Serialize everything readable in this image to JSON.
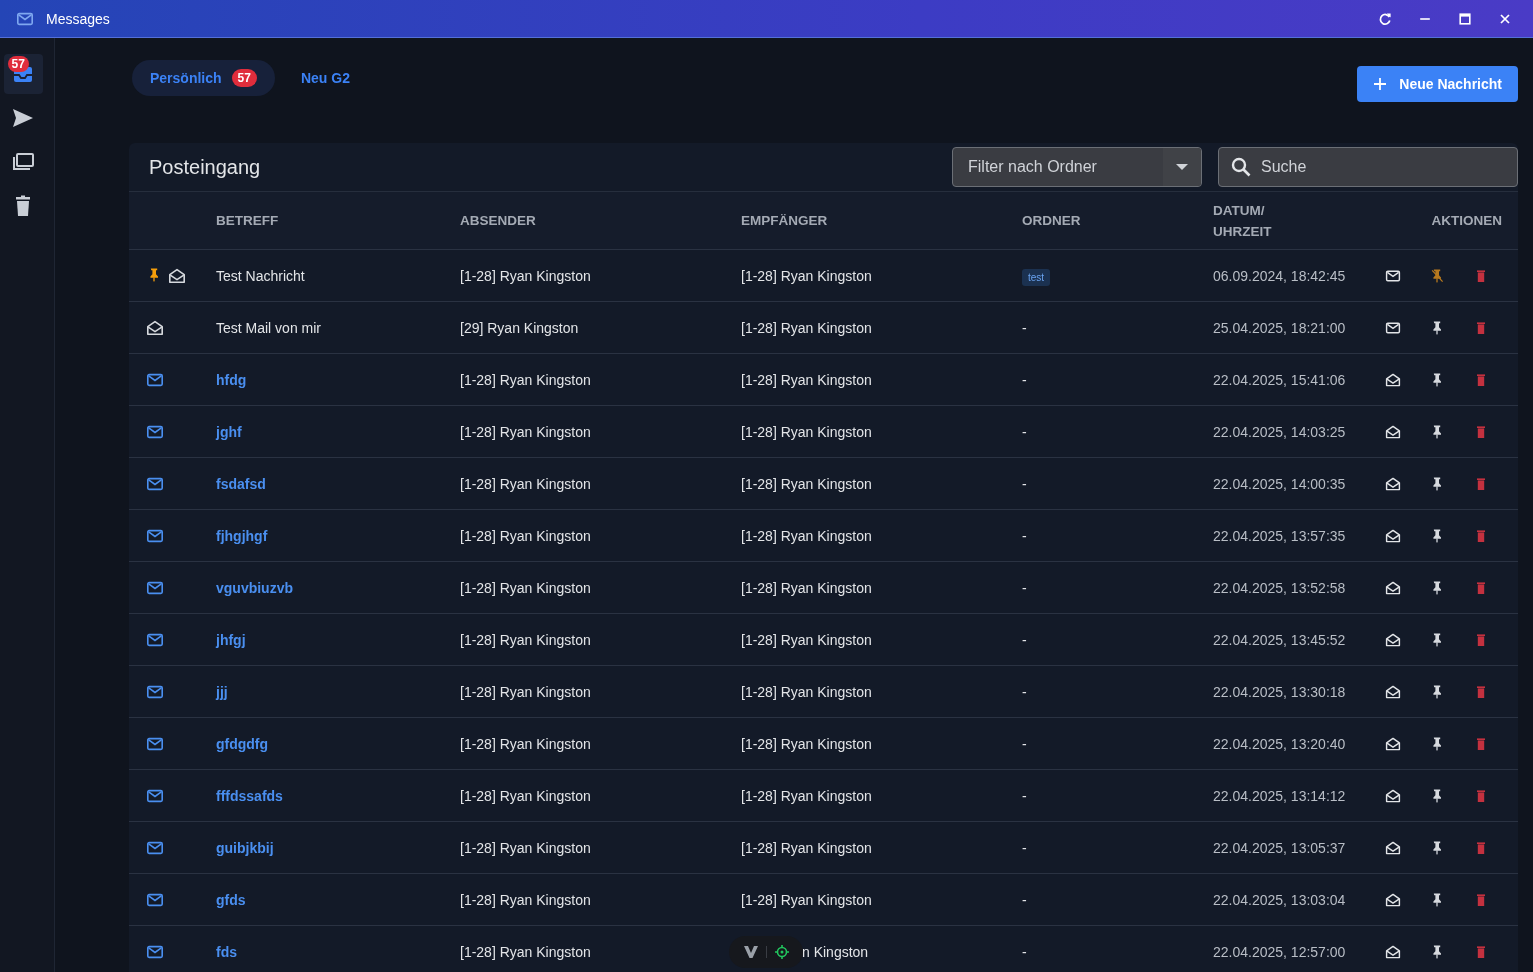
{
  "window": {
    "title": "Messages"
  },
  "sidebar": {
    "items": [
      {
        "kind": "inbox",
        "badge": "57",
        "selected": true
      },
      {
        "kind": "sent",
        "selected": false
      },
      {
        "kind": "folders",
        "selected": false
      },
      {
        "kind": "trash",
        "selected": false
      }
    ]
  },
  "tabs": [
    {
      "label": "Persönlich",
      "badge": "57",
      "selected": true
    },
    {
      "label": "Neu G2",
      "selected": false
    }
  ],
  "new_button": {
    "label": "Neue Nachricht"
  },
  "inbox": {
    "title": "Posteingang",
    "folder_filter": {
      "placeholder": "Filter nach Ordner"
    },
    "search": {
      "placeholder": "Suche"
    }
  },
  "table": {
    "columns": [
      "BETREFF",
      "ABSENDER",
      "EMPFÄNGER",
      "ORDNER",
      "DATUM/ UHRZEIT",
      "AKTIONEN"
    ],
    "rows": [
      {
        "pinned": true,
        "read": true,
        "subject": "Test Nachricht",
        "sender": "[1-28] Ryan Kingston",
        "recipient": "[1-28] Ryan Kingston",
        "folder": {
          "kind": "tag",
          "text": "test"
        },
        "date": "06.09.2024, 18:42:45"
      },
      {
        "pinned": false,
        "read": true,
        "subject": "Test Mail von mir",
        "sender": "[29] Ryan Kingston",
        "recipient": "[1-28] Ryan Kingston",
        "folder": {
          "kind": "text",
          "text": "-"
        },
        "date": "25.04.2025, 18:21:00"
      },
      {
        "pinned": false,
        "read": false,
        "subject": "hfdg",
        "sender": "[1-28] Ryan Kingston",
        "recipient": "[1-28] Ryan Kingston",
        "folder": {
          "kind": "text",
          "text": "-"
        },
        "date": "22.04.2025, 15:41:06"
      },
      {
        "pinned": false,
        "read": false,
        "subject": "jghf",
        "sender": "[1-28] Ryan Kingston",
        "recipient": "[1-28] Ryan Kingston",
        "folder": {
          "kind": "text",
          "text": "-"
        },
        "date": "22.04.2025, 14:03:25"
      },
      {
        "pinned": false,
        "read": false,
        "subject": "fsdafsd",
        "sender": "[1-28] Ryan Kingston",
        "recipient": "[1-28] Ryan Kingston",
        "folder": {
          "kind": "text",
          "text": "-"
        },
        "date": "22.04.2025, 14:00:35"
      },
      {
        "pinned": false,
        "read": false,
        "subject": "fjhgjhgf",
        "sender": "[1-28] Ryan Kingston",
        "recipient": "[1-28] Ryan Kingston",
        "folder": {
          "kind": "text",
          "text": "-"
        },
        "date": "22.04.2025, 13:57:35"
      },
      {
        "pinned": false,
        "read": false,
        "subject": "vguvbiuzvb",
        "sender": "[1-28] Ryan Kingston",
        "recipient": "[1-28] Ryan Kingston",
        "folder": {
          "kind": "text",
          "text": "-"
        },
        "date": "22.04.2025, 13:52:58"
      },
      {
        "pinned": false,
        "read": false,
        "subject": "jhfgj",
        "sender": "[1-28] Ryan Kingston",
        "recipient": "[1-28] Ryan Kingston",
        "folder": {
          "kind": "text",
          "text": "-"
        },
        "date": "22.04.2025, 13:45:52"
      },
      {
        "pinned": false,
        "read": false,
        "subject": "jjj",
        "sender": "[1-28] Ryan Kingston",
        "recipient": "[1-28] Ryan Kingston",
        "folder": {
          "kind": "text",
          "text": "-"
        },
        "date": "22.04.2025, 13:30:18"
      },
      {
        "pinned": false,
        "read": false,
        "subject": "gfdgdfg",
        "sender": "[1-28] Ryan Kingston",
        "recipient": "[1-28] Ryan Kingston",
        "folder": {
          "kind": "text",
          "text": "-"
        },
        "date": "22.04.2025, 13:20:40"
      },
      {
        "pinned": false,
        "read": false,
        "subject": "fffdssafds",
        "sender": "[1-28] Ryan Kingston",
        "recipient": "[1-28] Ryan Kingston",
        "folder": {
          "kind": "text",
          "text": "-"
        },
        "date": "22.04.2025, 13:14:12"
      },
      {
        "pinned": false,
        "read": false,
        "subject": "guibjkbij",
        "sender": "[1-28] Ryan Kingston",
        "recipient": "[1-28] Ryan Kingston",
        "folder": {
          "kind": "text",
          "text": "-"
        },
        "date": "22.04.2025, 13:05:37"
      },
      {
        "pinned": false,
        "read": false,
        "subject": "gfds",
        "sender": "[1-28] Ryan Kingston",
        "recipient": "[1-28] Ryan Kingston",
        "folder": {
          "kind": "text",
          "text": "-"
        },
        "date": "22.04.2025, 13:03:04"
      },
      {
        "pinned": false,
        "read": false,
        "subject": "fds",
        "sender": "[1-28] Ryan Kingston",
        "recipient": "n Kingston",
        "recipient_covered": true,
        "folder": {
          "kind": "text",
          "text": "-"
        },
        "date": "22.04.2025, 12:57:00"
      }
    ]
  }
}
